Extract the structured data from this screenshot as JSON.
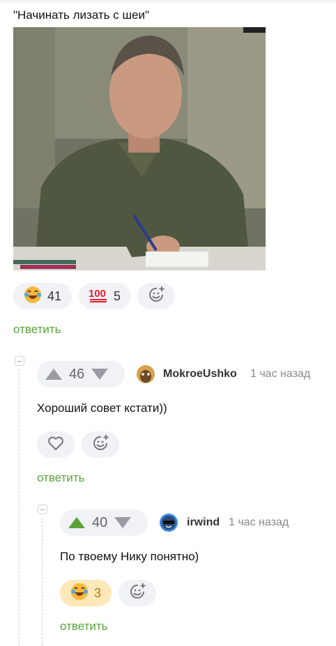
{
  "post": {
    "quote": "\"Начинать лизать с шеи\"",
    "reactions": [
      {
        "icon": "laughing-emoji-icon",
        "count": "41"
      },
      {
        "icon": "hundred-emoji-icon",
        "count": "5"
      }
    ],
    "reply_label": "ответить"
  },
  "comments": [
    {
      "votes": "46",
      "username": "MokroeUshko",
      "time": "1 час назад",
      "text": "Хороший совет кстати))",
      "reply_label": "ответить"
    },
    {
      "votes": "40",
      "username": "irwind",
      "time": "1 час назад",
      "text": "По твоему Нику понятно)",
      "reaction_count": "3",
      "reply_label": "ответить"
    }
  ],
  "colors": {
    "accent": "#5aa33a",
    "pill_bg": "#f1f2f6",
    "active_reaction_bg": "#fde8b8"
  }
}
